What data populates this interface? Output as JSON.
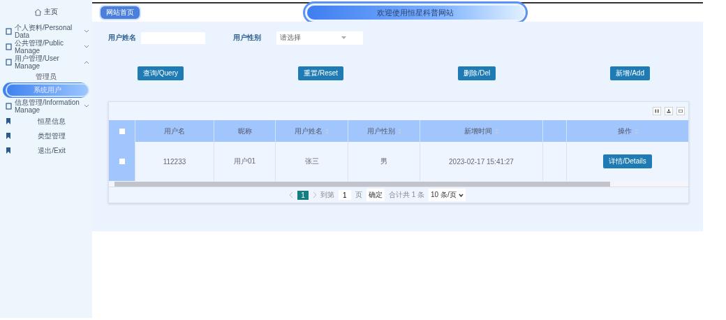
{
  "sidebar": {
    "home": "主页",
    "items": [
      {
        "kind": "group",
        "label": "个人资料/Personal Data",
        "expanded": false
      },
      {
        "kind": "group",
        "label": "公共管理/Public Manage",
        "expanded": false
      },
      {
        "kind": "group",
        "label": "用户管理/User Manage",
        "expanded": true,
        "children": [
          {
            "label": "管理员",
            "selected": false
          },
          {
            "label": "系统用户",
            "selected": true
          }
        ]
      },
      {
        "kind": "group",
        "label": "信息管理/Information Manage",
        "expanded": false
      },
      {
        "kind": "link",
        "label": "恒星信息"
      },
      {
        "kind": "link",
        "label": "类型管理"
      },
      {
        "kind": "link",
        "label": "退出/Exit"
      }
    ]
  },
  "header": {
    "breadcrumb": "网站首页",
    "title": "欢迎使用恒星科普网站"
  },
  "search": {
    "name_label": "用户姓名",
    "gender_label": "用户性别",
    "gender_placeholder": "请选择"
  },
  "buttons": [
    "查询/Query",
    "重置/Reset",
    "删除/Del",
    "新增/Add"
  ],
  "table": {
    "columns": [
      {
        "label": "用户名",
        "sortable": false
      },
      {
        "label": "昵称",
        "sortable": false
      },
      {
        "label": "用户姓名",
        "sortable": true
      },
      {
        "label": "用户性别",
        "sortable": true
      },
      {
        "label": "新增时间",
        "sortable": true
      },
      {
        "sortable": false
      },
      {
        "label": "操作",
        "sortable": true
      }
    ],
    "rows": [
      {
        "checked": false,
        "cells": [
          "112233",
          "用户01",
          "张三",
          "男",
          "2023-02-17 15:41:27"
        ],
        "action": "详情/Details"
      }
    ],
    "header_checked": false
  },
  "pagination": {
    "pages": [
      {
        "label": "1",
        "selected": true
      }
    ],
    "goto_label": "到第",
    "goto_value": "1",
    "page_unit": "页",
    "confirm": "确定",
    "total": "合计共 1 条",
    "page_size": "10 条/页"
  }
}
